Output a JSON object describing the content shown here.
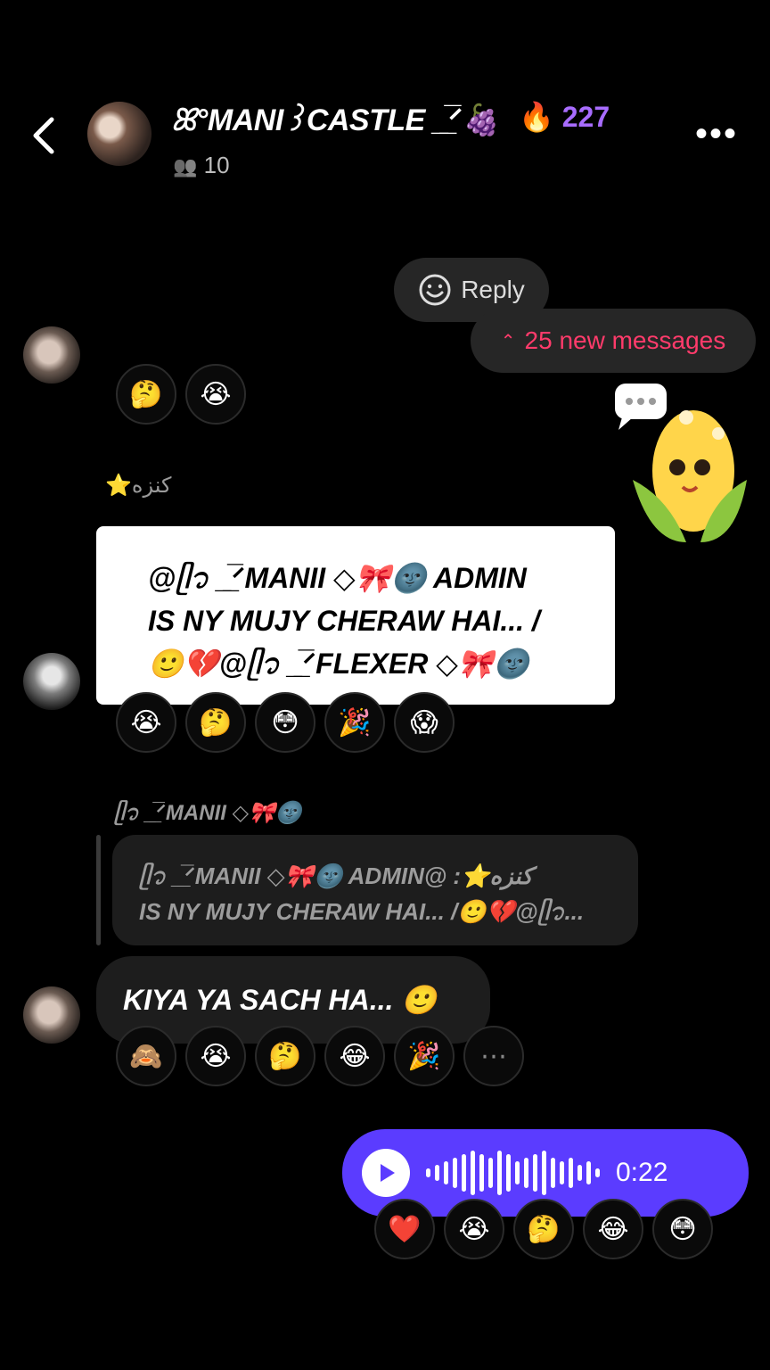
{
  "header": {
    "title": "ꕤ°MANI꒱CASTLE _̲̅ᐟ🍇",
    "streak_icon": "🔥",
    "streak_count": "227",
    "members_icon": "👥",
    "member_count": "10"
  },
  "reply": {
    "icon": "smiley-face-icon",
    "label": "Reply"
  },
  "new_messages": {
    "icon": "⌃",
    "label": "25 new messages"
  },
  "messages": [
    {
      "reactions": [
        "🤔",
        "😭"
      ]
    },
    {
      "sender": "⭐كنزه",
      "lines": [
        "@ᥫ᭡ _̲̅ᐟMANII ◇🎀🌚 ADMIN",
        "IS NY MUJY CHERAW HAI... /",
        "🙂💔@ᥫ᭡ _̲̅ᐟFLEXER ◇🎀🌚"
      ],
      "reactions": [
        "😭",
        "🤔",
        "😳",
        "🎉",
        "😱"
      ]
    },
    {
      "sender": "ᥫ᭡ _̲̅ᐟMANII ◇🎀🌚",
      "quote_lines": [
        "ᥫ᭡ _̲̅ᐟMANII ◇🎀🌚 ADMIN@ :⭐كنزه",
        "IS NY MUJY CHERAW HAI... /🙂💔@ᥫ᭡..."
      ],
      "text": "KIYA YA SACH HA... 🙂",
      "reactions": [
        "🙈",
        "😭",
        "🤔",
        "😂",
        "🎉",
        "⋯"
      ]
    },
    {
      "voice_duration": "0:22",
      "reactions": [
        "❤️",
        "😭",
        "🤔",
        "😂",
        "😳"
      ]
    }
  ],
  "sticker": {
    "bubble": "💬",
    "emoji": "🌽"
  },
  "colors": {
    "background": "#000000",
    "bubble": "#1d1d1d",
    "voice": "#5b3cff",
    "new_messages": "#ff3b6b",
    "streak": "#a86cff"
  }
}
